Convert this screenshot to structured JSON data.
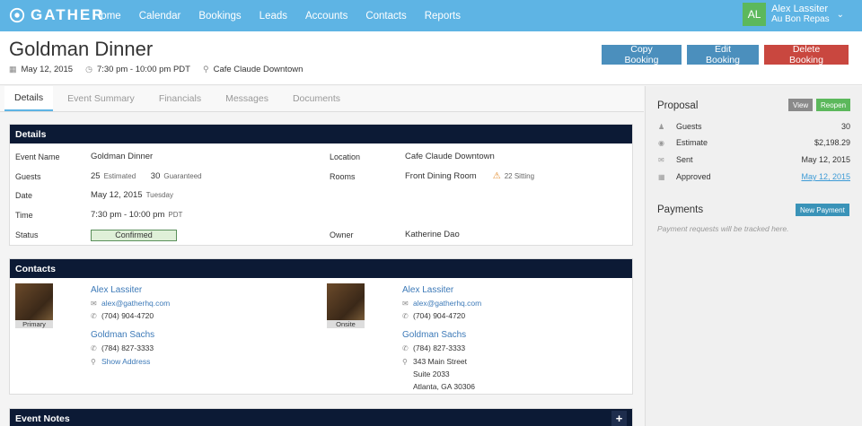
{
  "nav": {
    "logo_text": "GATHER",
    "items": [
      "Home",
      "Calendar",
      "Bookings",
      "Leads",
      "Accounts",
      "Contacts",
      "Reports"
    ],
    "user": {
      "initials": "AL",
      "name": "Alex Lassiter",
      "org": "Au Bon Repas"
    }
  },
  "header": {
    "title": "Goldman Dinner",
    "date": "May 12, 2015",
    "time": "7:30 pm - 10:00 pm PDT",
    "location": "Cafe Claude Downtown",
    "buttons": {
      "copy": "Copy Booking",
      "edit": "Edit Booking",
      "delete": "Delete Booking"
    }
  },
  "tabs": [
    "Details",
    "Event Summary",
    "Financials",
    "Messages",
    "Documents"
  ],
  "details": {
    "heading": "Details",
    "event_name_label": "Event Name",
    "event_name": "Goldman Dinner",
    "guests_label": "Guests",
    "guests_estimated": "25",
    "estimated_label": "Estimated",
    "guests_guaranteed": "30",
    "guaranteed_label": "Guaranteed",
    "date_label": "Date",
    "date": "May 12, 2015",
    "weekday": "Tuesday",
    "time_label": "Time",
    "time": "7:30 pm  -  10:00 pm",
    "tz": "PDT",
    "status_label": "Status",
    "status": "Confirmed",
    "location_label": "Location",
    "location": "Cafe Claude Downtown",
    "rooms_label": "Rooms",
    "room": "Front Dining Room",
    "sitting": "22 Sitting",
    "owner_label": "Owner",
    "owner": "Katherine Dao"
  },
  "contacts": {
    "heading": "Contacts",
    "left": {
      "photo_label": "Primary",
      "name": "Alex Lassiter",
      "email": "alex@gatherhq.com",
      "phone": "(704) 904-4720",
      "company": "Goldman Sachs",
      "company_phone": "(784) 827-3333",
      "show_address": "Show Address"
    },
    "right": {
      "photo_label": "Onsite",
      "name": "Alex Lassiter",
      "email": "alex@gatherhq.com",
      "phone": "(704) 904-4720",
      "company": "Goldman Sachs",
      "company_phone": "(784) 827-3333",
      "address_1": "343 Main Street",
      "address_2": "Suite 2033",
      "address_3": "Atlanta, GA 30306"
    }
  },
  "event_notes": {
    "heading": "Event Notes",
    "add": "+"
  },
  "proposal": {
    "heading": "Proposal",
    "view": "View",
    "reopen": "Reopen",
    "rows": [
      {
        "label": "Guests",
        "value": "30"
      },
      {
        "label": "Estimate",
        "value": "$2,198.29"
      },
      {
        "label": "Sent",
        "value": "May 12, 2015"
      },
      {
        "label": "Approved",
        "value": "May 12, 2015"
      }
    ]
  },
  "payments": {
    "heading": "Payments",
    "new_payment": "New Payment",
    "note": "Payment requests will be tracked here."
  },
  "colors": {
    "nav_bg": "#5eb4e4",
    "panel_head": "#0c1a35",
    "button_blue": "#4b8fbd",
    "button_red": "#c9473f",
    "status_green": "#dff0d8"
  }
}
